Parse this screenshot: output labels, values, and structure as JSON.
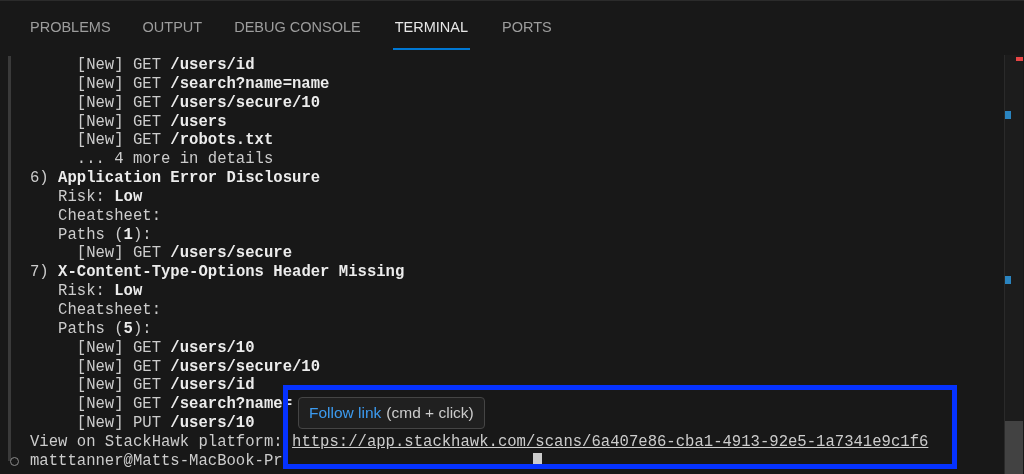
{
  "tabs": [
    {
      "label": "PROBLEMS",
      "selected": false
    },
    {
      "label": "OUTPUT",
      "selected": false
    },
    {
      "label": "DEBUG CONSOLE",
      "selected": false
    },
    {
      "label": "TERMINAL",
      "selected": true
    },
    {
      "label": "PORTS",
      "selected": false
    }
  ],
  "terminal": {
    "lines": [
      {
        "kind": "path",
        "text": "[New] GET **/users/id**"
      },
      {
        "kind": "path",
        "text": "[New] GET **/search?name=name**"
      },
      {
        "kind": "path",
        "text": "[New] GET **/users/secure/10**"
      },
      {
        "kind": "path",
        "text": "[New] GET **/users**"
      },
      {
        "kind": "path",
        "text": "[New] GET **/robots.txt**"
      },
      {
        "kind": "more",
        "text": "... 4 more in details"
      },
      {
        "kind": "heading",
        "text": "6) **Application Error Disclosure**"
      },
      {
        "kind": "field",
        "text": "Risk: **Low**"
      },
      {
        "kind": "field",
        "text": "Cheatsheet:"
      },
      {
        "kind": "field",
        "text": "Paths (**1**):"
      },
      {
        "kind": "path",
        "text": "[New] GET **/users/secure**"
      },
      {
        "kind": "heading",
        "text": "7) **X-Content-Type-Options Header Missing**"
      },
      {
        "kind": "field",
        "text": "Risk: **Low**"
      },
      {
        "kind": "field",
        "text": "Cheatsheet:"
      },
      {
        "kind": "field",
        "text": "Paths (**5**):"
      },
      {
        "kind": "path",
        "text": "[New] GET **/users/10**"
      },
      {
        "kind": "path",
        "text": "[New] GET **/users/secure/10**"
      },
      {
        "kind": "path",
        "text": "[New] GET **/users/id**"
      },
      {
        "kind": "path",
        "text": "[New] GET **/search?name=**"
      },
      {
        "kind": "path",
        "text": "[New] PUT **/users/10**"
      },
      {
        "kind": "link",
        "label": "View on StackHawk platform:",
        "url": "https://app.stackhawk.com/scans/6a407e86-cba1-4913-92e5-1a7341e9c1f6"
      },
      {
        "kind": "prompt",
        "text": "matttanner@Matts-MacBook-Pr"
      }
    ]
  },
  "tooltip": {
    "link": "Follow link",
    "hint": "(cmd + click)"
  }
}
